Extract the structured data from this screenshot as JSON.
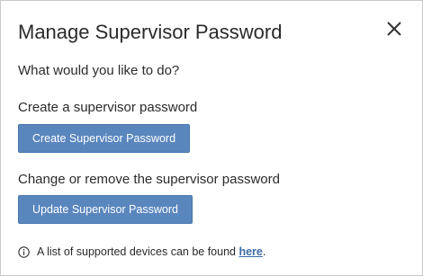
{
  "dialog": {
    "title": "Manage Supervisor Password",
    "close_icon": "close-icon",
    "question": "What would you like to do?",
    "create_section": {
      "label": "Create a supervisor password",
      "button_label": "Create Supervisor Password"
    },
    "update_section": {
      "label": "Change or remove the supervisor password",
      "button_label": "Update Supervisor Password"
    },
    "info": {
      "icon": "info-icon",
      "text": "A list of supported devices can be found ",
      "link_text": "here",
      "suffix": "."
    }
  },
  "colors": {
    "button_bg": "#5a86be",
    "link": "#3a6aa8",
    "text": "#2b2b2b"
  }
}
